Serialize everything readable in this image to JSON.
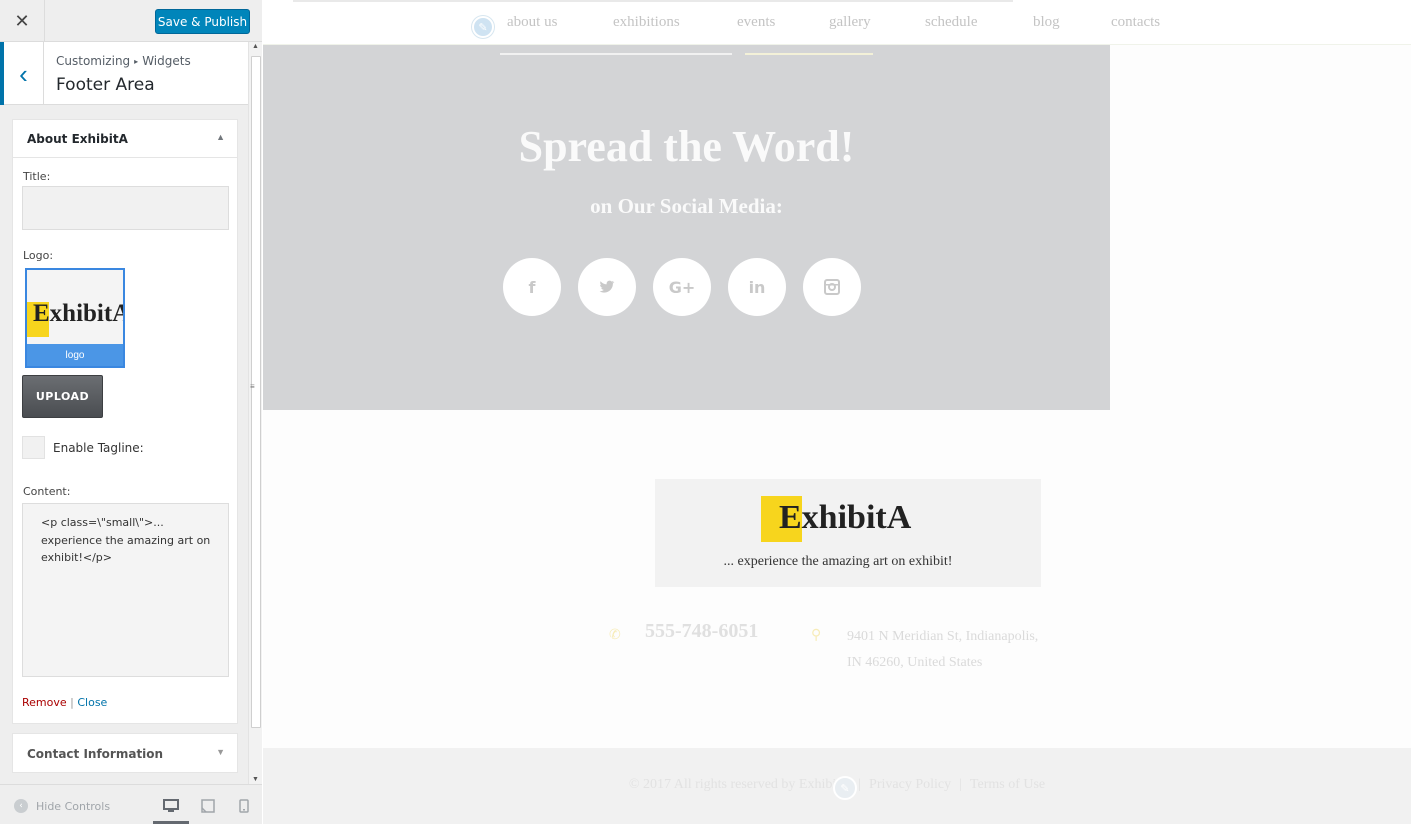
{
  "sidebar": {
    "close_icon": "✕",
    "save_label": "Save & Publish",
    "back_icon": "‹",
    "breadcrumb": {
      "root": "Customizing",
      "separator": "▸",
      "current": "Widgets"
    },
    "section_title": "Footer Area",
    "widget": {
      "title": "About ExhibitA",
      "toggle_icon": "▲",
      "title_label": "Title:",
      "title_value": "",
      "logo_label": "Logo:",
      "logo_text": "ExhibitA",
      "logo_caption": "logo",
      "upload_label": "UPLOAD",
      "tagline_label": "Enable Tagline:",
      "tagline_checked": false,
      "content_label": "Content:",
      "content_value": "<p class=\\\"small\\\">... experience the amazing art on exhibit!</p>",
      "remove_label": "Remove",
      "actions_separator": "|",
      "close_label": "Close"
    },
    "widget2": {
      "title": "Contact Information",
      "toggle_icon": "▼"
    },
    "footer": {
      "hide_label": "Hide Controls",
      "hide_icon": "‹",
      "devices": [
        "desktop",
        "tablet",
        "mobile"
      ],
      "active_device": "desktop"
    }
  },
  "preview": {
    "nav": [
      "about us",
      "exhibitions",
      "events",
      "gallery",
      "schedule",
      "blog",
      "contacts"
    ],
    "social": {
      "title": "Spread the Word!",
      "subtitle": "on Our Social Media:",
      "icons": [
        "f",
        "t",
        "G+",
        "in",
        "ig"
      ]
    },
    "footer_logo": {
      "text": "ExhibitA",
      "tagline": "... experience the amazing art on exhibit!"
    },
    "contact": {
      "phone": "555-748-6051",
      "address_line1": "9401 N Meridian St, Indianapolis,",
      "address_line2": "IN 46260, United States"
    },
    "copyright": {
      "text": "© 2017 All rights reserved by ExhibitA",
      "privacy": "Privacy Policy",
      "terms": "Terms of Use",
      "separator": "|"
    }
  },
  "colors": {
    "accent": "#0085ba",
    "brand_yellow": "#f7d51d",
    "link_red": "#aa0000",
    "link_blue": "#0073aa"
  }
}
